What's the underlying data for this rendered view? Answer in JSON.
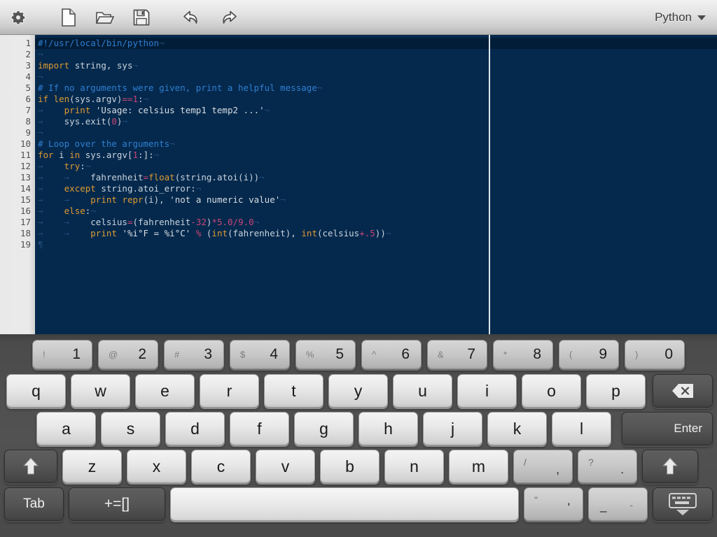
{
  "toolbar": {
    "buttons": [
      {
        "name": "settings-button",
        "icon": "gear-icon"
      },
      {
        "name": "new-file-button",
        "icon": "new-document-icon"
      },
      {
        "name": "open-file-button",
        "icon": "open-folder-icon"
      },
      {
        "name": "save-file-button",
        "icon": "save-floppy-icon"
      },
      {
        "name": "undo-button",
        "icon": "undo-arrow-icon"
      },
      {
        "name": "redo-button",
        "icon": "redo-arrow-icon"
      }
    ],
    "language_label": "Python",
    "language_caret_icon": "chevron-down-icon"
  },
  "editor": {
    "language": "Python",
    "current_line": 1,
    "total_lines": 19,
    "margin_column_rule": true,
    "colors": {
      "background": "#05294d",
      "current_line_background": "#021d38",
      "gutter_background": "#e9e9e9",
      "gutter_text": "#4f4f4f",
      "comment": "#2f7fd1",
      "keyword": "#dd9a31",
      "string": "#d8dde2",
      "number": "#cc4477",
      "operator": "#cc4477",
      "plain": "#c9d3dd",
      "whitespace_marker": "#1f4c78",
      "margin_rule": "#dfe6ec"
    },
    "lines": [
      {
        "n": 1,
        "text": "#!/usr/local/bin/python¬"
      },
      {
        "n": 2,
        "text": "¬"
      },
      {
        "n": 3,
        "text": "import string, sys¬"
      },
      {
        "n": 4,
        "text": "¬"
      },
      {
        "n": 5,
        "text": "# If no arguments were given, print a helpful message¬"
      },
      {
        "n": 6,
        "text": "if len(sys.argv)==1:¬"
      },
      {
        "n": 7,
        "text": "→    print 'Usage: celsius temp1 temp2 ...'¬"
      },
      {
        "n": 8,
        "text": "→    sys.exit(0)¬"
      },
      {
        "n": 9,
        "text": "¬"
      },
      {
        "n": 10,
        "text": "# Loop over the arguments¬"
      },
      {
        "n": 11,
        "text": "for i in sys.argv[1:]:¬"
      },
      {
        "n": 12,
        "text": "→    try:¬"
      },
      {
        "n": 13,
        "text": "→    →    fahrenheit=float(string.atoi(i))¬"
      },
      {
        "n": 14,
        "text": "→    except string.atoi_error:¬"
      },
      {
        "n": 15,
        "text": "→    →    print repr(i), 'not a numeric value'¬"
      },
      {
        "n": 16,
        "text": "→    else:¬"
      },
      {
        "n": 17,
        "text": "→    →    celsius=(fahrenheit-32)*5.0/9.0¬"
      },
      {
        "n": 18,
        "text": "→    →    print '%i°F = %i°C' % (int(fahrenheit), int(celsius+.5))¬"
      },
      {
        "n": 19,
        "text": "¶"
      }
    ]
  },
  "keyboard": {
    "number_row": [
      {
        "sym": "!",
        "num": "1"
      },
      {
        "sym": "@",
        "num": "2"
      },
      {
        "sym": "#",
        "num": "3"
      },
      {
        "sym": "$",
        "num": "4"
      },
      {
        "sym": "%",
        "num": "5"
      },
      {
        "sym": "^",
        "num": "6"
      },
      {
        "sym": "&",
        "num": "7"
      },
      {
        "sym": "*",
        "num": "8"
      },
      {
        "sym": "(",
        "num": "9"
      },
      {
        "sym": ")",
        "num": "0"
      }
    ],
    "row_q": [
      "q",
      "w",
      "e",
      "r",
      "t",
      "y",
      "u",
      "i",
      "o",
      "p"
    ],
    "backspace": {
      "name": "backspace-key",
      "icon": "backspace-icon"
    },
    "row_a": [
      "a",
      "s",
      "d",
      "f",
      "g",
      "h",
      "j",
      "k",
      "l"
    ],
    "enter_label": "Enter",
    "row_z": [
      "z",
      "x",
      "c",
      "v",
      "b",
      "n",
      "m"
    ],
    "shift_left": {
      "name": "shift-left-key",
      "icon": "shift-up-arrow-icon"
    },
    "shift_right": {
      "name": "shift-right-key",
      "icon": "shift-up-arrow-icon"
    },
    "slash_comma": {
      "up": "/",
      "lo": ","
    },
    "question_period": {
      "up": "?",
      "lo": "."
    },
    "tab_label": "Tab",
    "symbols_label": "+=[]",
    "space_label": "",
    "quote_key": {
      "up": "\"",
      "lo": "'"
    },
    "dash_key": {
      "up": "_",
      "lo": "-"
    },
    "hide_keyboard": {
      "name": "hide-keyboard-key",
      "icon": "keyboard-down-icon"
    }
  }
}
